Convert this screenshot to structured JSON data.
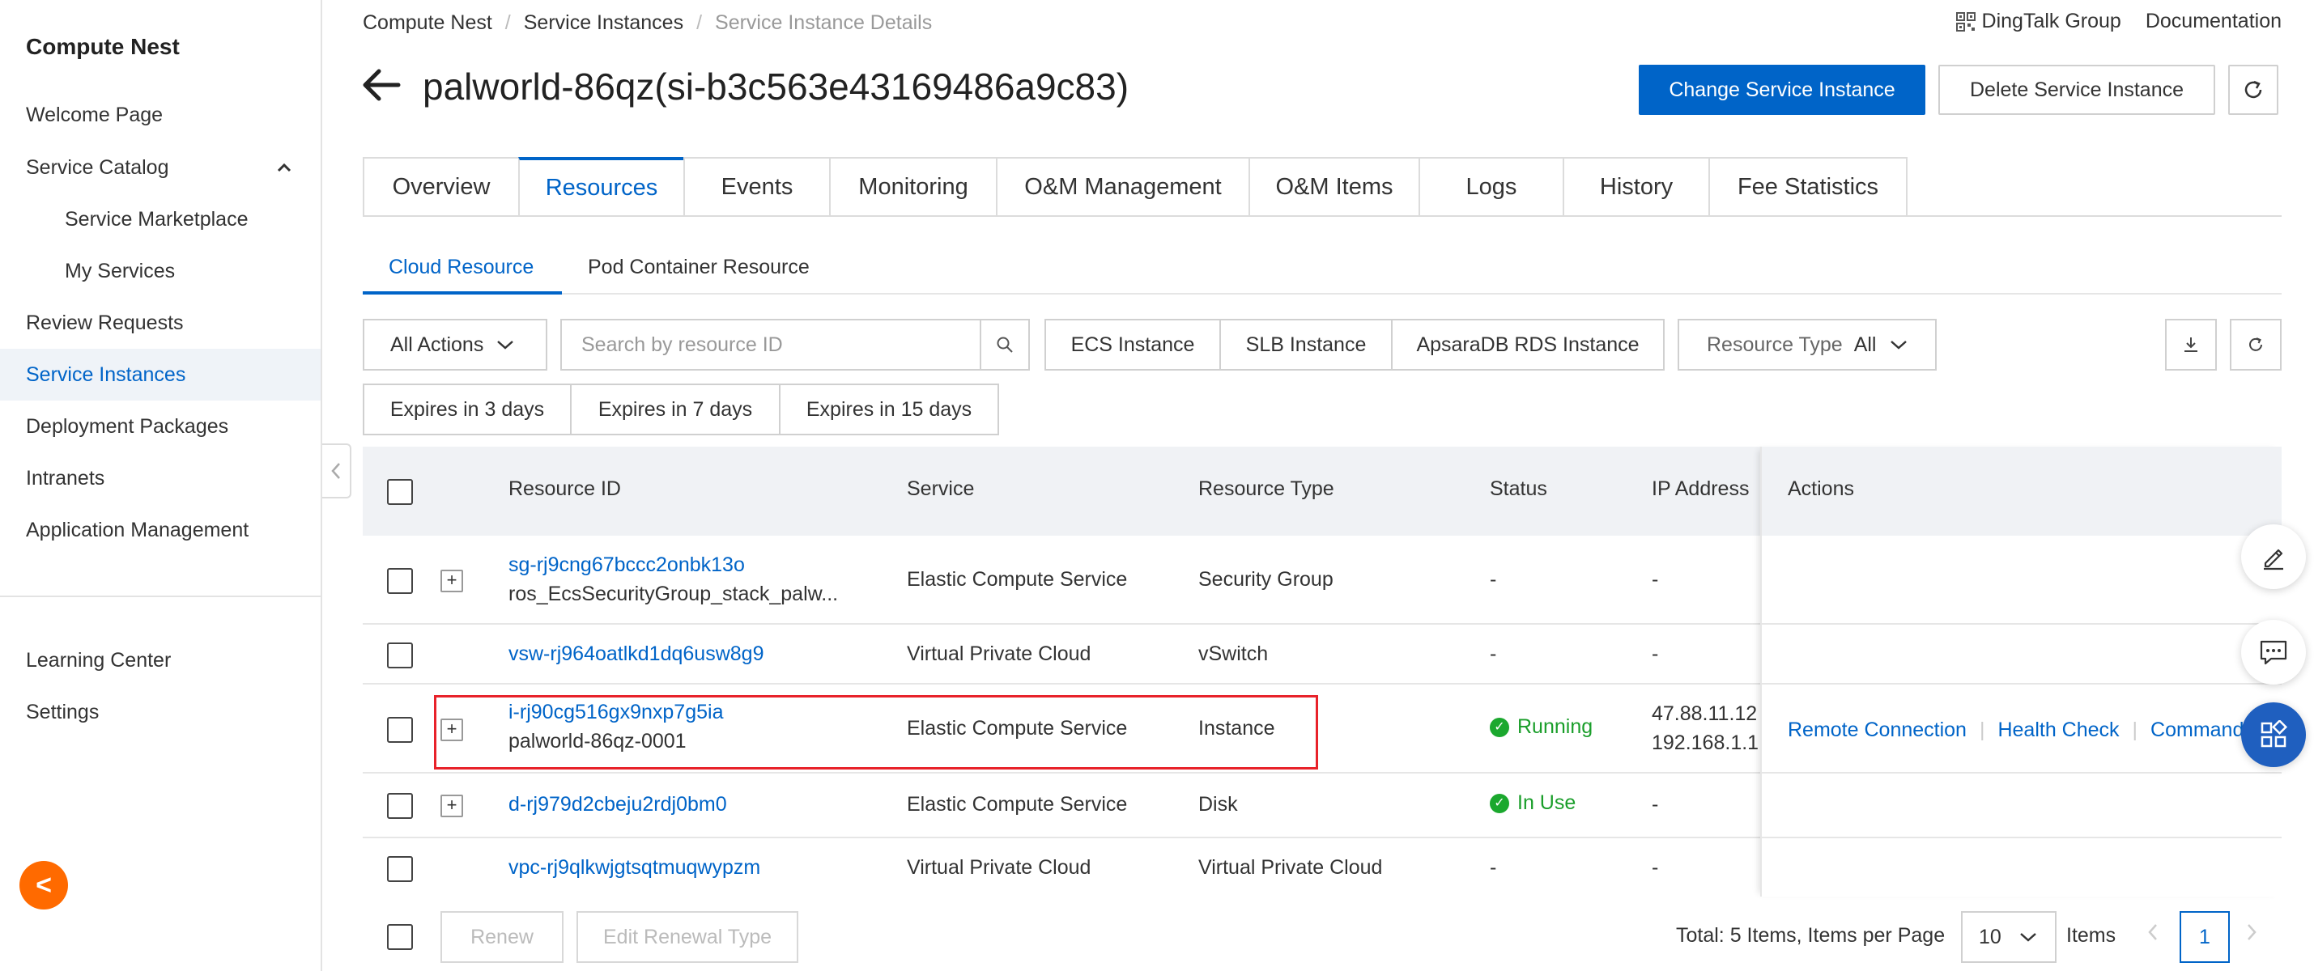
{
  "sidebar": {
    "title": "Compute Nest",
    "items": [
      {
        "label": "Welcome Page"
      },
      {
        "label": "Service Catalog"
      },
      {
        "label": "Service Marketplace"
      },
      {
        "label": "My Services"
      },
      {
        "label": "Review Requests"
      },
      {
        "label": "Service Instances"
      },
      {
        "label": "Deployment Packages"
      },
      {
        "label": "Intranets"
      },
      {
        "label": "Application Management"
      }
    ],
    "bottom_items": [
      {
        "label": "Learning Center"
      },
      {
        "label": "Settings"
      }
    ],
    "collapse_glyph": "<"
  },
  "breadcrumb": [
    "Compute Nest",
    "Service Instances",
    "Service Instance Details"
  ],
  "top_links": {
    "dingtalk": "DingTalk Group",
    "documentation": "Documentation"
  },
  "page": {
    "title": "palworld-86qz(si-b3c563e43169486a9c83)",
    "change_button": "Change Service Instance",
    "delete_button": "Delete Service Instance"
  },
  "main_tabs": [
    "Overview",
    "Resources",
    "Events",
    "Monitoring",
    "O&M Management",
    "O&M Items",
    "Logs",
    "History",
    "Fee Statistics"
  ],
  "sub_tabs": [
    "Cloud Resource",
    "Pod Container Resource"
  ],
  "toolbar": {
    "all_actions": "All Actions",
    "search_placeholder": "Search by resource ID",
    "filters": [
      "ECS Instance",
      "SLB Instance",
      "ApsaraDB RDS Instance"
    ],
    "resource_type_label": "Resource Type",
    "resource_type_value": "All",
    "expires": [
      "Expires in 3 days",
      "Expires in 7 days",
      "Expires in 15 days"
    ]
  },
  "table": {
    "columns": [
      "Resource ID",
      "Service",
      "Resource Type",
      "Status",
      "IP Address",
      "Actions"
    ],
    "rows": [
      {
        "id": "sg-rj9cng67bccc2onbk13o",
        "name": "ros_EcsSecurityGroup_stack_palw...",
        "service": "Elastic Compute Service",
        "type": "Security Group",
        "status": "-",
        "ip": "-",
        "ip2": ""
      },
      {
        "id": "vsw-rj964oatlkd1dq6usw8g9",
        "name": "",
        "service": "Virtual Private Cloud",
        "type": "vSwitch",
        "status": "-",
        "ip": "-",
        "ip2": ""
      },
      {
        "id": "i-rj90cg516gx9nxp7g5ia",
        "name": "palworld-86qz-0001",
        "service": "Elastic Compute Service",
        "type": "Instance",
        "status": "Running",
        "ip": "47.88.11.12",
        "ip2": "192.168.1.1"
      },
      {
        "id": "d-rj979d2cbeju2rdj0bm0",
        "name": "",
        "service": "Elastic Compute Service",
        "type": "Disk",
        "status": "In Use",
        "ip": "-",
        "ip2": ""
      },
      {
        "id": "vpc-rj9qlkwjgtsqtmuqwypzm",
        "name": "",
        "service": "Virtual Private Cloud",
        "type": "Virtual Private Cloud",
        "status": "-",
        "ip": "-",
        "ip2": ""
      }
    ],
    "row_actions": [
      "Remote Connection",
      "Health Check",
      "Command"
    ]
  },
  "footer": {
    "renew": "Renew",
    "edit_renewal": "Edit Renewal Type",
    "total_text": "Total: 5 Items,  Items per Page",
    "page_size": "10",
    "items_label": "Items",
    "current_page": "1"
  },
  "icons": {
    "back": "arrow-left-icon",
    "refresh": "refresh-icon",
    "search": "search-icon",
    "download": "download-icon",
    "edit": "edit-icon",
    "chat": "chat-icon",
    "apps": "apps-icon"
  },
  "colors": {
    "accent": "#0064c8",
    "success": "#1ba82e",
    "highlight": "#e8222a",
    "orange": "#ff6a00"
  }
}
